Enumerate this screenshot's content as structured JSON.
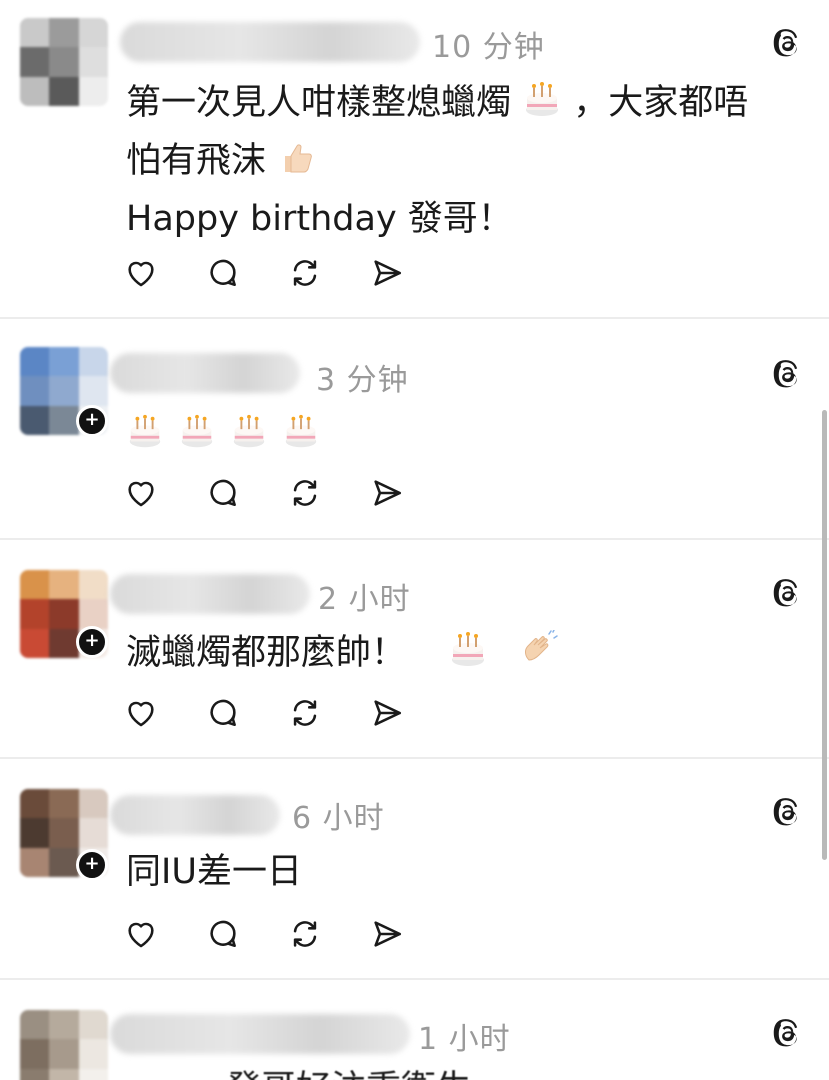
{
  "posts": [
    {
      "timestamp": "10 分钟",
      "body_lines": [
        "第一次見人咁樣整熄蠟燭",
        "，大家都唔",
        "怕有飛沫",
        "Happy birthday 發哥！"
      ],
      "emoji": [
        "birthday-cake",
        "thumbs-up"
      ]
    },
    {
      "timestamp": "3 分钟",
      "emoji_row": [
        "birthday-cake",
        "birthday-cake",
        "birthday-cake",
        "birthday-cake"
      ]
    },
    {
      "timestamp": "2 小时",
      "body_lines": [
        "滅蠟燭都那麼帥！"
      ],
      "emoji": [
        "birthday-cake",
        "clapping-hands"
      ]
    },
    {
      "timestamp": "6 小时",
      "body_lines": [
        "同IU差一日"
      ]
    },
    {
      "timestamp": "1 小时",
      "body_lines": [
        "發哥好注重衛生"
      ]
    }
  ],
  "actions": [
    "heart-icon",
    "comment-icon",
    "repost-icon",
    "share-icon"
  ],
  "colors": {
    "text": "#1a1a1a",
    "timestamp": "#9a9a9a",
    "divider": "#ececec",
    "background": "#ffffff"
  }
}
